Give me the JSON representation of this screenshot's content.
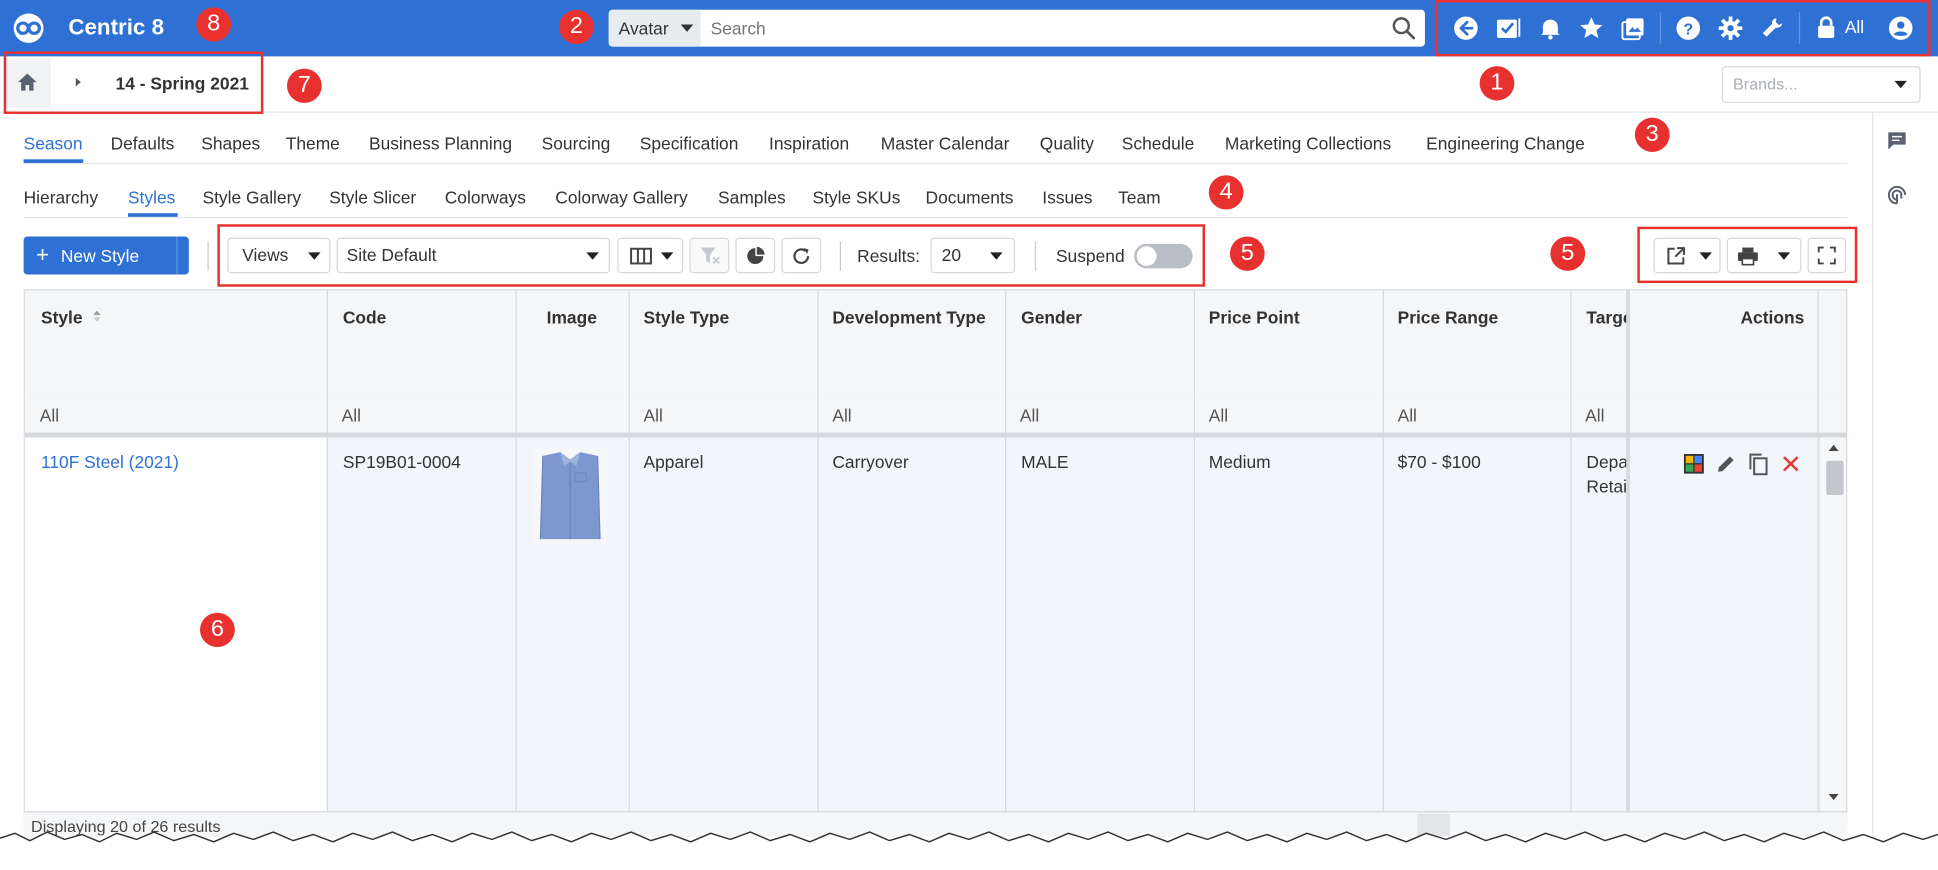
{
  "topbar": {
    "app_title": "Centric 8",
    "search_scope": "Avatar",
    "search_placeholder": "Search",
    "all_label": "All"
  },
  "breadcrumb": {
    "current": "14 - Spring 2021",
    "brands_placeholder": "Brands..."
  },
  "primary_tabs": [
    "Season",
    "Defaults",
    "Shapes",
    "Theme",
    "Business Planning",
    "Sourcing",
    "Specification",
    "Inspiration",
    "Master Calendar",
    "Quality",
    "Schedule",
    "Marketing Collections",
    "Engineering Change"
  ],
  "primary_tabs_active": "Season",
  "secondary_tabs": [
    "Hierarchy",
    "Styles",
    "Style Gallery",
    "Style Slicer",
    "Colorways",
    "Colorway Gallery",
    "Samples",
    "Style SKUs",
    "Documents",
    "Issues",
    "Team"
  ],
  "secondary_tabs_active": "Styles",
  "toolbar": {
    "new_style_label": "New Style",
    "views_label": "Views",
    "view_selected": "Site Default",
    "results_label": "Results:",
    "results_value": "20",
    "suspend_label": "Suspend",
    "suspend_on": false
  },
  "grid": {
    "columns": [
      "Style",
      "Code",
      "Image",
      "Style Type",
      "Development Type",
      "Gender",
      "Price Point",
      "Price Range",
      "Targe",
      "Actions"
    ],
    "filter_text": "All",
    "rows": [
      {
        "style": "110F Steel (2021)",
        "code": "SP19B01-0004",
        "style_type": "Apparel",
        "development_type": "Carryover",
        "gender": "MALE",
        "price_point": "Medium",
        "price_range": "$70 - $100",
        "target_line1": "Depa",
        "target_line2": "Retail"
      }
    ],
    "footer_text": "Displaying 20 of 26 results"
  },
  "callouts": {
    "n1": "1",
    "n2": "2",
    "n3": "3",
    "n4": "4",
    "n5a": "5",
    "n5b": "5",
    "n6": "6",
    "n7": "7",
    "n8": "8"
  },
  "colors": {
    "brand_blue": "#2f70d4",
    "annotation_red": "#e8312f",
    "delete_red": "#e53935"
  }
}
